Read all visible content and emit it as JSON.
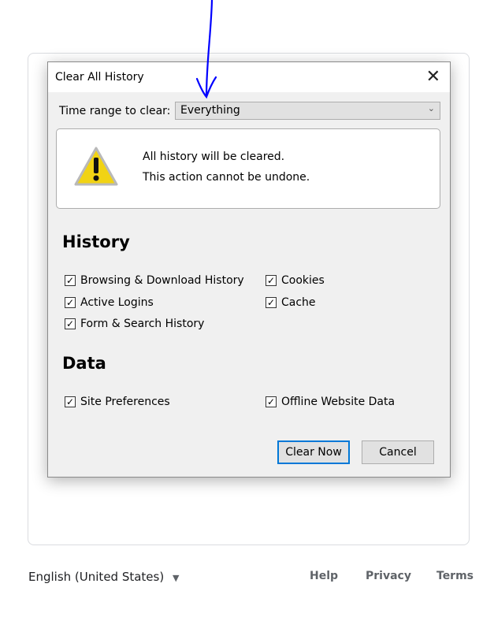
{
  "dialog": {
    "title": "Clear All History",
    "time_range_label": "Time range to clear:",
    "time_range_value": "Everything",
    "warning_line1": "All history will be cleared.",
    "warning_line2": "This action cannot be undone.",
    "history_heading": "History",
    "data_heading": "Data",
    "history_items": [
      {
        "label": "Browsing & Download History",
        "checked": true
      },
      {
        "label": "Cookies",
        "checked": true
      },
      {
        "label": "Active Logins",
        "checked": true
      },
      {
        "label": "Cache",
        "checked": true
      },
      {
        "label": "Form & Search History",
        "checked": true
      }
    ],
    "data_items": [
      {
        "label": "Site Preferences",
        "checked": true
      },
      {
        "label": "Offline Website Data",
        "checked": true
      }
    ],
    "clear_now": "Clear Now",
    "cancel": "Cancel",
    "check_glyph": "✓",
    "close_glyph": "✕",
    "chevron_glyph": "⌄"
  },
  "footer": {
    "language": "English (United States)",
    "help": "Help",
    "privacy": "Privacy",
    "terms": "Terms"
  },
  "colors": {
    "annotation": "#0000ff",
    "focus": "#0078d7"
  }
}
